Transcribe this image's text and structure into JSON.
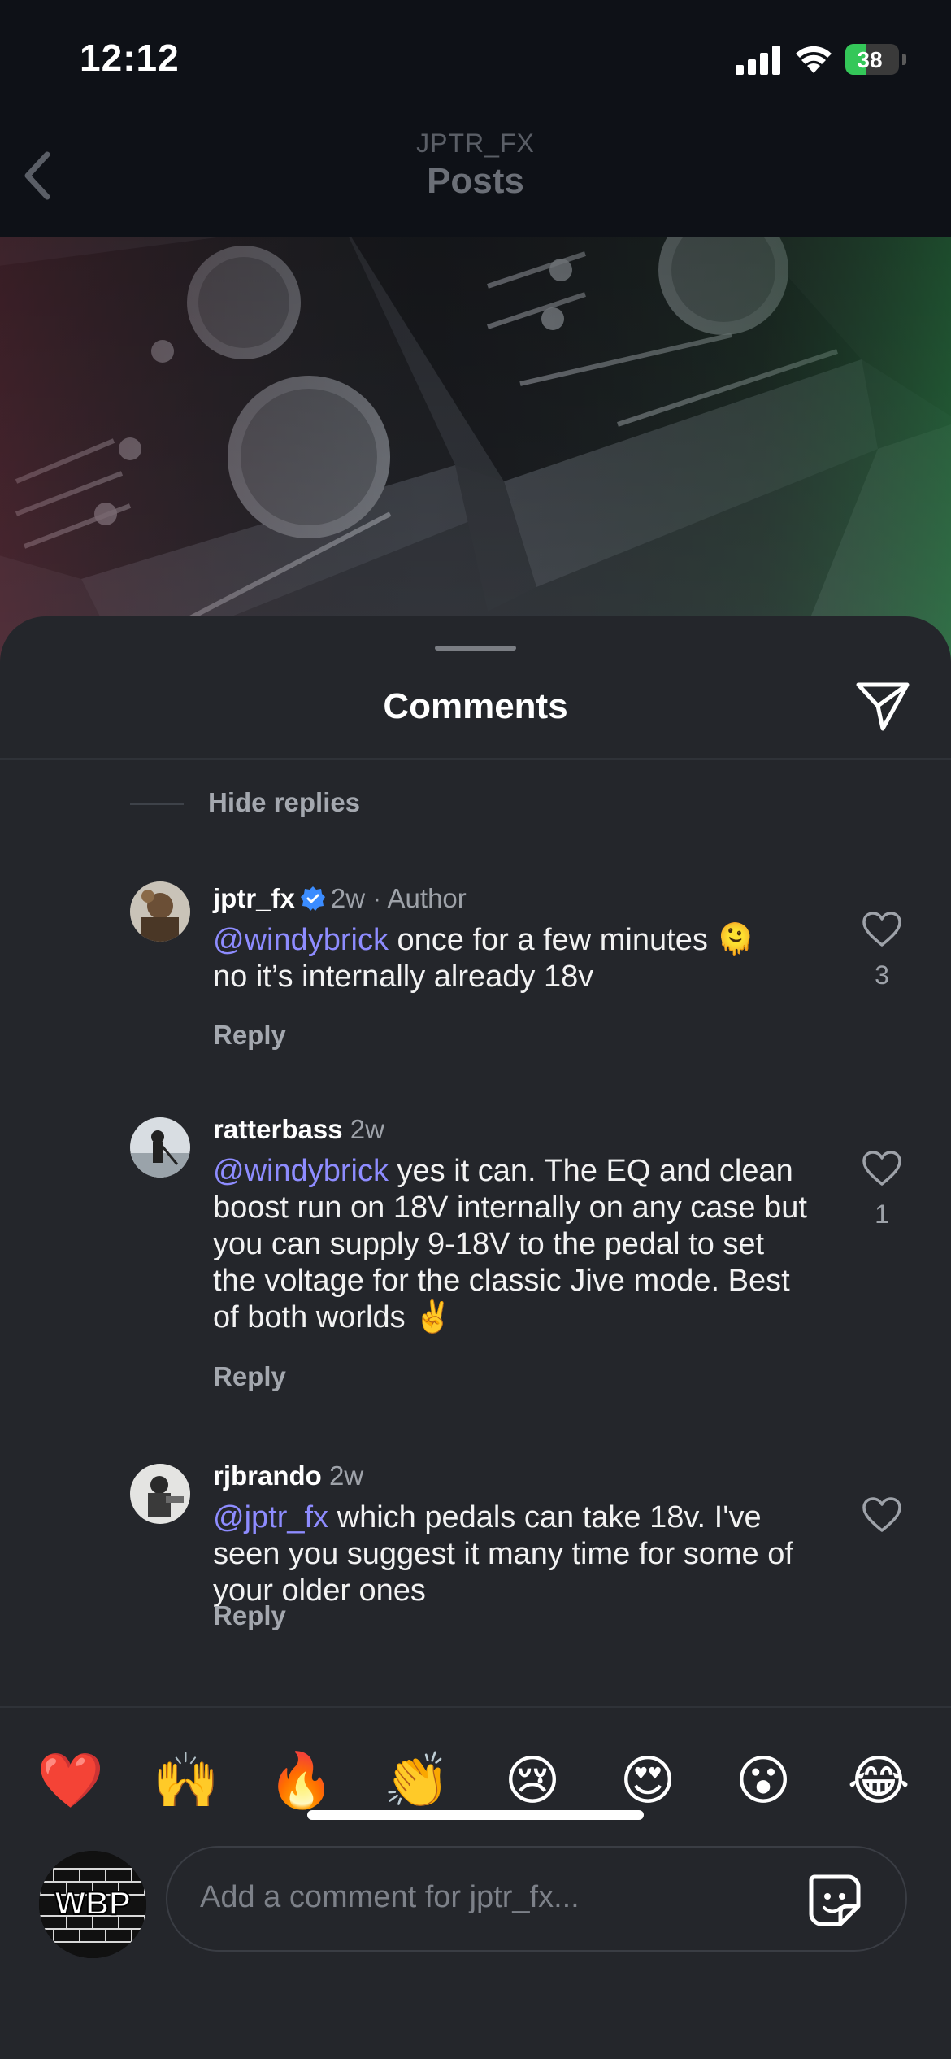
{
  "status_bar": {
    "time": "12:12",
    "battery": "38",
    "battery_level": 0.38
  },
  "nav": {
    "account": "JPTR_FX",
    "title": "Posts"
  },
  "sheet": {
    "title": "Comments",
    "hide_replies_label": "Hide replies"
  },
  "comments": [
    {
      "username": "jptr_fx",
      "verified": true,
      "meta": "2w · Author",
      "mention": "@windybrick",
      "text": " once for a few minutes 🫠\nno it’s internally already 18v",
      "reply_label": "Reply",
      "likes": "3"
    },
    {
      "username": "ratterbass",
      "verified": false,
      "meta": "2w",
      "mention": "@windybrick",
      "text": " yes it can. The EQ and clean boost run on 18V internally on any case but you can supply 9-18V to the pedal to set the voltage for the classic Jive mode. Best of both worlds ✌️",
      "reply_label": "Reply",
      "likes": "1"
    },
    {
      "username": "rjbrando",
      "verified": false,
      "meta": "2w",
      "mention": "@jptr_fx",
      "text": " which pedals can take 18v. I've seen you suggest it many time for some of your older ones",
      "reply_label": "Reply",
      "likes": ""
    }
  ],
  "emoji_reactions": [
    "❤️",
    "🙌",
    "🔥",
    "👏",
    "😢",
    "😍",
    "😮",
    "😂"
  ],
  "composer": {
    "avatar_text": "WBP",
    "placeholder": "Add a comment for jptr_fx..."
  },
  "colors": {
    "background": "#0e1117",
    "sheet": "#24262b",
    "mention": "#8e8cff",
    "verified": "#3b8cff",
    "muted": "#9ea2a9"
  },
  "icons": [
    "back-chevron-icon",
    "share-send-icon",
    "verified-badge-icon",
    "heart-icon",
    "sticker-icon",
    "signal-icon",
    "wifi-icon",
    "battery-icon"
  ]
}
